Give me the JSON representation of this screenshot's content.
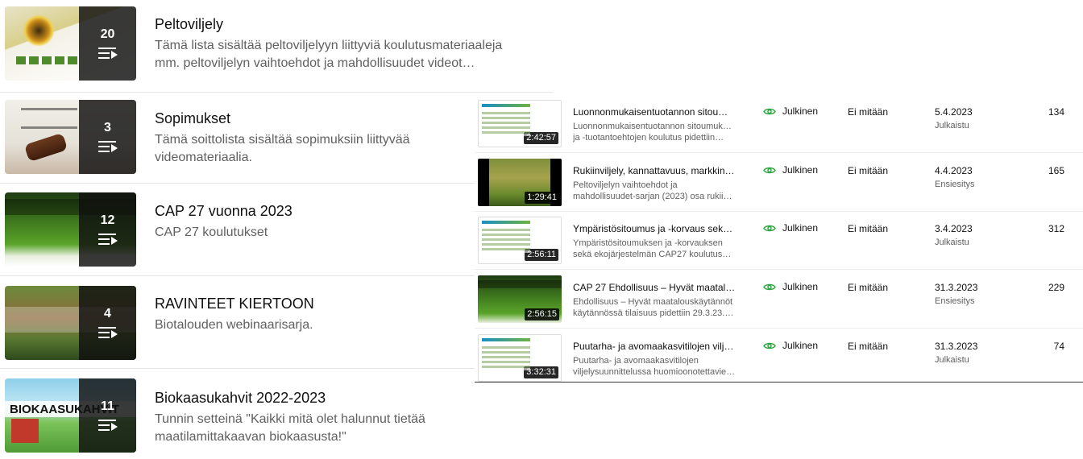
{
  "colors": {
    "accent_eye": "#2ba640",
    "text": "#0f0f0f",
    "muted": "#606060"
  },
  "playlists": [
    {
      "title": "Peltoviljely",
      "count": "20",
      "desc": [
        "Tämä lista sisältää peltoviljelyyn liittyviä koulutusmateriaaleja",
        "mm. peltoviljelyn vaihtoehdot ja mahdollisuudet videot…"
      ]
    },
    {
      "title": "Sopimukset",
      "count": "3",
      "desc": [
        "Tämä soittolista sisältää sopimuksiin liittyvää",
        "videomateriaalia."
      ]
    },
    {
      "title": "CAP 27 vuonna 2023",
      "count": "12",
      "desc": [
        "CAP 27 koulutukset"
      ]
    },
    {
      "title": "RAVINTEET KIERTOON",
      "count": "4",
      "desc": [
        "Biotalouden webinaarisarja."
      ]
    },
    {
      "title": "Biokaasukahvit 2022-2023",
      "count": "11",
      "thumb_text": "BIOKAASUKAHVIT",
      "desc": [
        "Tunnin setteinä \"Kaikki mitä olet halunnut tietää",
        "maatilamittakaavan biokaasusta!\""
      ]
    }
  ],
  "videos": [
    {
      "title": "Luonnonmukaisentuotannon sitoumus…",
      "desc": [
        "Luonnonmukaisentuotannon sitoumuksen",
        "ja -tuotantoehtojen koulutus pidettiin…"
      ],
      "duration": "2:42:57",
      "visibility": "Julkinen",
      "restrictions": "Ei mitään",
      "date": "5.4.2023",
      "status": "Julkaistu",
      "views": "134"
    },
    {
      "title": "Rukiinviljely, kannattavuus, markkinat j…",
      "desc": [
        "Peltoviljelyn vaihtoehdot ja",
        "mahdollisuudet-sarjan (2023) osa rukiin…"
      ],
      "duration": "1:29:41",
      "visibility": "Julkinen",
      "restrictions": "Ei mitään",
      "date": "4.4.2023",
      "status": "Ensiesitys",
      "views": "165"
    },
    {
      "title": "Ympäristösitoumus ja -korvaus sekä e…",
      "desc": [
        "Ympäristösitoumuksen ja -korvauksen",
        "sekä ekojärjestelmän CAP27 koulutus…"
      ],
      "duration": "2:56:11",
      "visibility": "Julkinen",
      "restrictions": "Ei mitään",
      "date": "3.4.2023",
      "status": "Julkaistu",
      "views": "312"
    },
    {
      "title": "CAP 27 Ehdollisuus – Hyvät maatalou…",
      "desc": [
        "Ehdollisuus – Hyvät maatalouskäytännöt",
        "käytännössä tilaisuus pidettiin 29.3.23.…"
      ],
      "duration": "2:56:15",
      "visibility": "Julkinen",
      "restrictions": "Ei mitään",
      "date": "31.3.2023",
      "status": "Ensiesitys",
      "views": "229"
    },
    {
      "title": "Puutarha- ja avomaakasvitilojen viljely…",
      "desc": [
        "Puutarha- ja avomaakasvitilojen",
        "viljelysuunnittelussa huomioonotettavien…"
      ],
      "duration": "3:32:31",
      "visibility": "Julkinen",
      "restrictions": "Ei mitään",
      "date": "31.3.2023",
      "status": "Julkaistu",
      "views": "74"
    }
  ]
}
